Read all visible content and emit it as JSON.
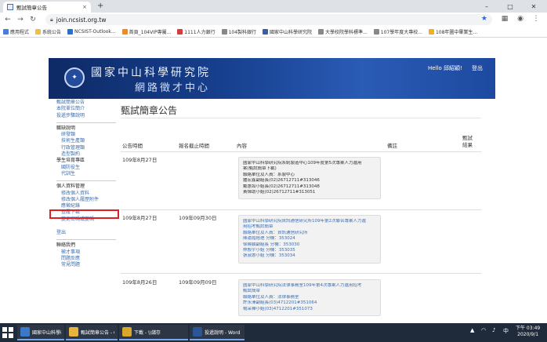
{
  "browser": {
    "tab_title": "甄試簡章公告",
    "new_tab": "+",
    "minimize": "–",
    "maximize": "□",
    "close": "✕",
    "tab_close": "×",
    "url": "join.ncsist.org.tw",
    "bookmarks": [
      {
        "label": "應用程式",
        "color": "#4a7cd8"
      },
      {
        "label": "系統公告",
        "color": "#f0c040"
      },
      {
        "label": "NCSIST-Outlook...",
        "color": "#2b6fc9"
      },
      {
        "label": "首頁_104VIP專屬...",
        "color": "#f08a24"
      },
      {
        "label": "1111人力銀行",
        "color": "#d93a3a"
      },
      {
        "label": "104製科銀行",
        "color": "#888888"
      },
      {
        "label": "國家中山科學研究院",
        "color": "#3a5fa8"
      },
      {
        "label": "大學校院學科標準...",
        "color": "#888888"
      },
      {
        "label": "107學年度大專校...",
        "color": "#888888"
      },
      {
        "label": "108年圖中畢業生...",
        "color": "#f0b020"
      }
    ]
  },
  "site": {
    "banner_title": "國家中山科學研究院",
    "banner_subtitle": "網路徵才中心",
    "greeting": "Hello 邱紹穎!",
    "logout": "登出"
  },
  "sidebar": {
    "top_links": [
      "甄試簡章公告",
      "本院單位簡介",
      "投遞步驟說明"
    ],
    "job_section": {
      "heading": "職缺說明",
      "items": [
        "研發類",
        "技術生產類",
        "行政管理類",
        "造型製約"
      ]
    },
    "student_section": {
      "heading": "學生培育專區",
      "items": [
        "國防役生",
        "代訓生"
      ]
    },
    "personal_section": {
      "heading": "個人資料管理",
      "items": [
        "修改個人資料",
        "修改個人履歷附件",
        "應徵紀錄",
        "查履下載",
        "變更密碼或變碼"
      ]
    },
    "logout": "登出",
    "contact_section": {
      "heading": "聯絡我們",
      "items": [
        "徵才事項",
        "問題反應",
        "常見問題"
      ]
    }
  },
  "main": {
    "page_title": "甄試簡章公告",
    "columns": {
      "date": "公告時間",
      "deadline": "報名截止時間",
      "content": "內容",
      "note": "備註",
      "result_line1": "甄試",
      "result_line2": "結果"
    },
    "rows": [
      {
        "date": "109年8月27日",
        "deadline": "",
        "lines": [
          {
            "text": "國家中山科學研究院系統製造中心109年度第5次專案人力進用",
            "c": "bk"
          },
          {
            "text": "案(甄試簡章下載)",
            "c": "bk"
          },
          {
            "text": "聯絡單位及人員：系製中心",
            "c": "bk"
          },
          {
            "text": "鍾宏鑫副組長(02)26712711#313046",
            "c": "bk"
          },
          {
            "text": "戴惠如小姐長(02)26712711#313048",
            "c": "bk"
          },
          {
            "text": "黃偉助小姐(02)26712711#313051",
            "c": "bk"
          }
        ]
      },
      {
        "date": "109年8月27日",
        "deadline": "109年09月30日",
        "lines": [
          {
            "text": "國家中山科學研究院資訊通信研究所109年第2次聯合專案人力進",
            "c": "bl"
          },
          {
            "text": "用招考甄試簡章",
            "c": "bl"
          },
          {
            "text": "聯絡單位及人員：資訊通信研究所",
            "c": "bl"
          },
          {
            "text": "陳運霞經理 分機：353024",
            "c": "bl"
          },
          {
            "text": "徐曉穎副組長 分機：353030",
            "c": "bl"
          },
          {
            "text": "林殷宇小姐 分機：353035",
            "c": "bl"
          },
          {
            "text": "張淑惠小姐 分機：353034",
            "c": "bl"
          }
        ]
      },
      {
        "date": "109年8月26日",
        "deadline": "109年09月09日",
        "lines": [
          {
            "text": "國家中山科學研究院法律事務室109年第4次專案人力進用招考",
            "c": "bl"
          },
          {
            "text": "甄試簡章",
            "c": "bl"
          },
          {
            "text": "聯絡單位及人員：法律事務室",
            "c": "bl"
          },
          {
            "text": "許永澤副組長(03)4712201#351064",
            "c": "bl"
          },
          {
            "text": "楊采樺小姐(03)4712201#351073",
            "c": "bl"
          }
        ]
      }
    ]
  },
  "taskbar": {
    "apps": [
      {
        "label": "國家中山科學研...",
        "color": "#3a78c8"
      },
      {
        "label": "甄試簡章公告 - G...",
        "color": "#e8b33c"
      },
      {
        "label": "下載 - \\\\儲存",
        "color": "#d9a82a"
      },
      {
        "label": "投遞說明 - Word ...",
        "color": "#2b5797"
      }
    ],
    "tray_lang": "中",
    "time": "下午 03:49",
    "date": "2020/9/1"
  }
}
